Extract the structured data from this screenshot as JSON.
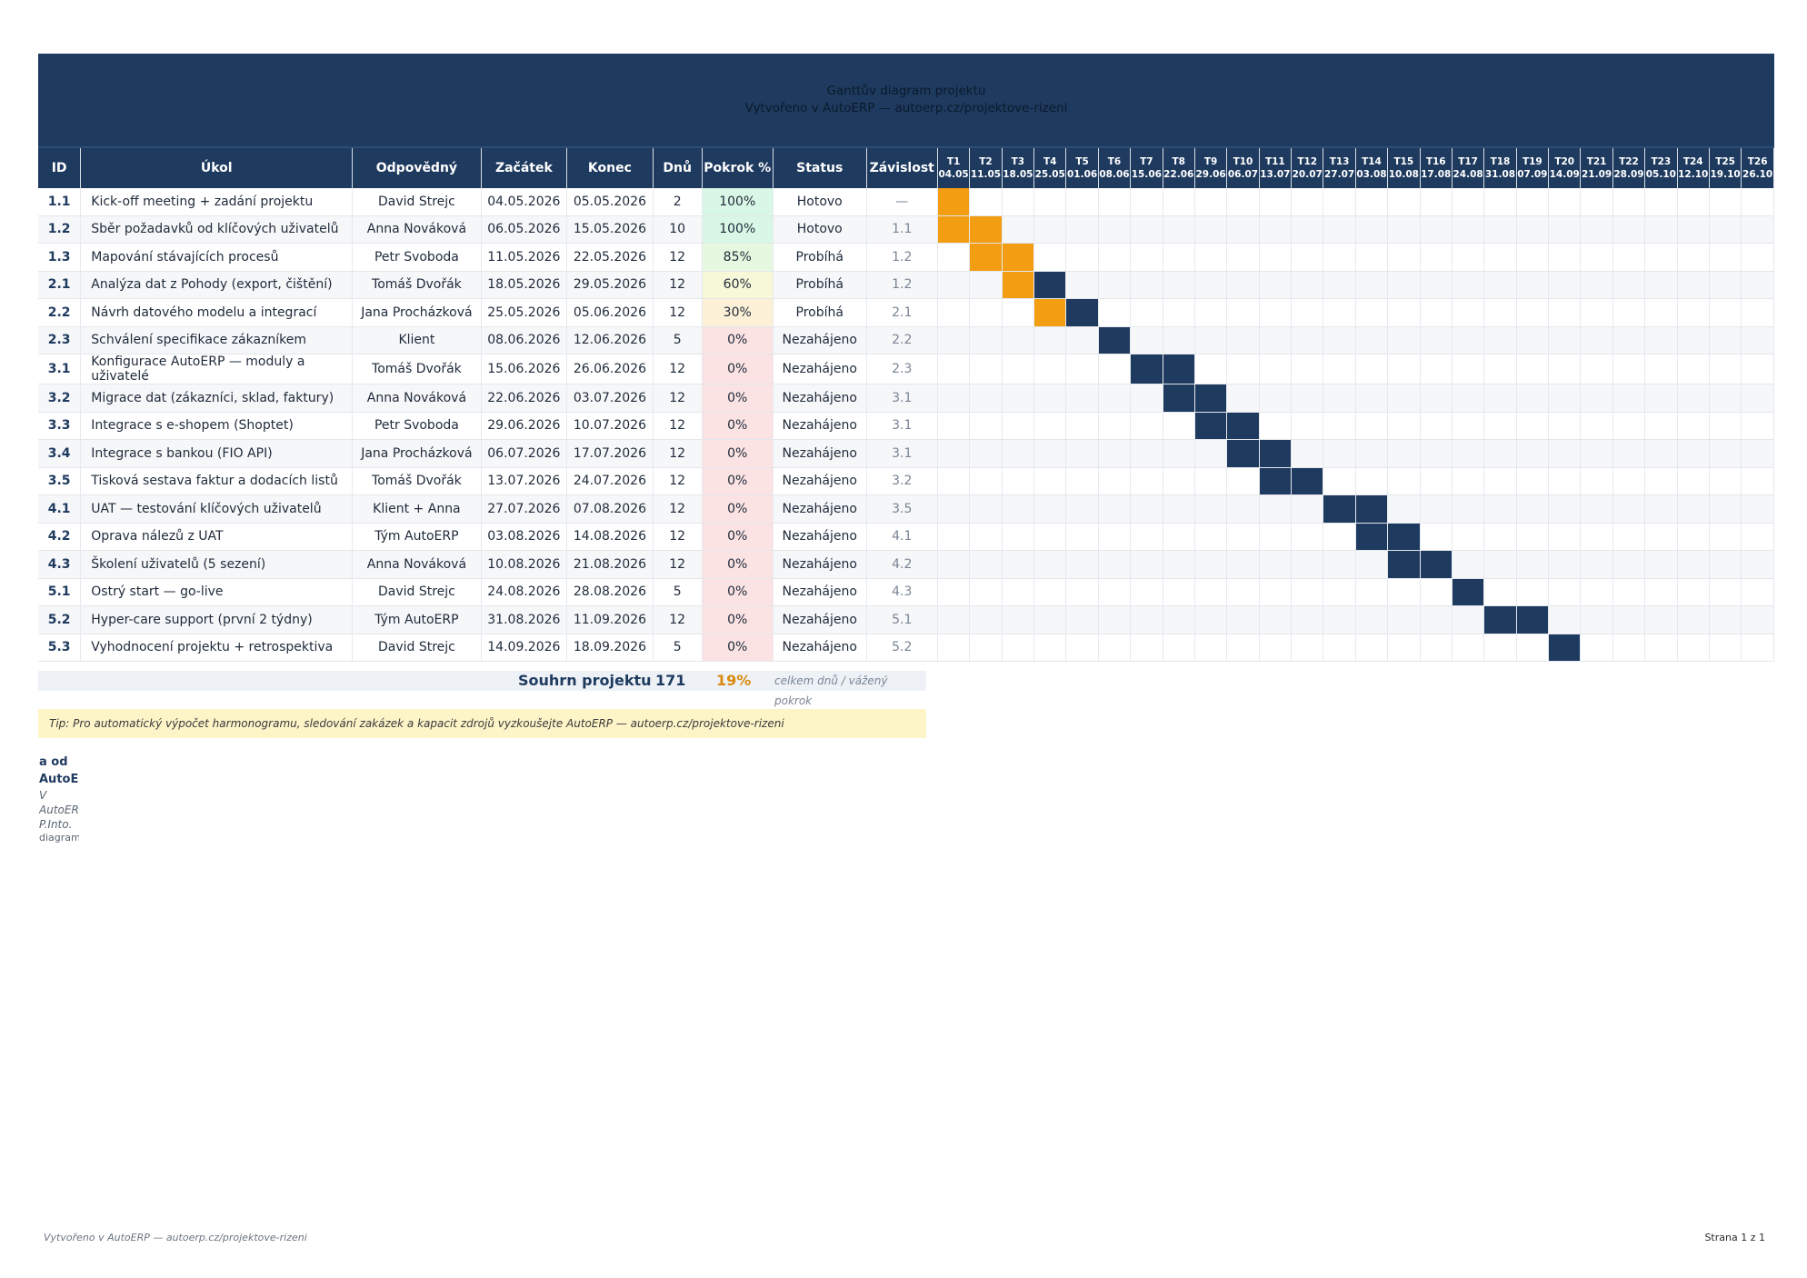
{
  "banner": {
    "title": "Ganttův diagram projektu",
    "subtitle": "Vytvořeno v AutoERP — autoerp.cz/projektove-rizeni"
  },
  "columns": {
    "id": "ID",
    "task": "Úkol",
    "owner": "Odpovědný",
    "start": "Začátek",
    "end": "Konec",
    "days": "Dnů",
    "progress": "Pokrok %",
    "status": "Status",
    "dependency": "Závislost"
  },
  "weeks": [
    {
      "label": "T1",
      "date": "04.05"
    },
    {
      "label": "T2",
      "date": "11.05"
    },
    {
      "label": "T3",
      "date": "18.05"
    },
    {
      "label": "T4",
      "date": "25.05"
    },
    {
      "label": "T5",
      "date": "01.06"
    },
    {
      "label": "T6",
      "date": "08.06"
    },
    {
      "label": "T7",
      "date": "15.06"
    },
    {
      "label": "T8",
      "date": "22.06"
    },
    {
      "label": "T9",
      "date": "29.06"
    },
    {
      "label": "T10",
      "date": "06.07"
    },
    {
      "label": "T11",
      "date": "13.07"
    },
    {
      "label": "T12",
      "date": "20.07"
    },
    {
      "label": "T13",
      "date": "27.07"
    },
    {
      "label": "T14",
      "date": "03.08"
    },
    {
      "label": "T15",
      "date": "10.08"
    },
    {
      "label": "T16",
      "date": "17.08"
    },
    {
      "label": "T17",
      "date": "24.08"
    },
    {
      "label": "T18",
      "date": "31.08"
    },
    {
      "label": "T19",
      "date": "07.09"
    },
    {
      "label": "T20",
      "date": "14.09"
    },
    {
      "label": "T21",
      "date": "21.09"
    },
    {
      "label": "T22",
      "date": "28.09"
    },
    {
      "label": "T23",
      "date": "05.10"
    },
    {
      "label": "T24",
      "date": "12.10"
    },
    {
      "label": "T25",
      "date": "19.10"
    },
    {
      "label": "T26",
      "date": "26.10"
    }
  ],
  "tasks": [
    {
      "id": "1.1",
      "task": "Kick-off meeting + zadání projektu",
      "owner": "David Strejc",
      "start": "04.05.2026",
      "end": "05.05.2026",
      "days": "2",
      "progress": "100%",
      "progress_color": "#d9f7e6",
      "status": "Hotovo",
      "dependency": "—",
      "bar_weeks": [
        1,
        1
      ],
      "bar_color": "#f29d12"
    },
    {
      "id": "1.2",
      "task": "Sběr požadavků od klíčových uživatelů",
      "owner": "Anna Nováková",
      "start": "06.05.2026",
      "end": "15.05.2026",
      "days": "10",
      "progress": "100%",
      "progress_color": "#d9f7e6",
      "status": "Hotovo",
      "dependency": "1.1",
      "bar_weeks": [
        1,
        2
      ],
      "bar_color": "#f29d12"
    },
    {
      "id": "1.3",
      "task": "Mapování stávajících procesů",
      "owner": "Petr Svoboda",
      "start": "11.05.2026",
      "end": "22.05.2026",
      "days": "12",
      "progress": "85%",
      "progress_color": "#e6f8df",
      "status": "Probíhá",
      "dependency": "1.2",
      "bar_weeks": [
        2,
        3
      ],
      "bar_color": "#f29d12"
    },
    {
      "id": "2.1",
      "task": "Analýza dat z Pohody (export, čištění)",
      "owner": "Tomáš Dvořák",
      "start": "18.05.2026",
      "end": "29.05.2026",
      "days": "12",
      "progress": "60%",
      "progress_color": "#f7f8d8",
      "status": "Probíhá",
      "dependency": "1.2",
      "bar_weeks": [
        3,
        4
      ],
      "bar_color": "split"
    },
    {
      "id": "2.2",
      "task": "Návrh datového modelu a integrací",
      "owner": "Jana Procházková",
      "start": "25.05.2026",
      "end": "05.06.2026",
      "days": "12",
      "progress": "30%",
      "progress_color": "#fcf0d6",
      "status": "Probíhá",
      "dependency": "2.1",
      "bar_weeks": [
        4,
        5
      ],
      "bar_color": "split"
    },
    {
      "id": "2.3",
      "task": "Schválení specifikace zákazníkem",
      "owner": "Klient",
      "start": "08.06.2026",
      "end": "12.06.2026",
      "days": "5",
      "progress": "0%",
      "progress_color": "#fbe3e3",
      "status": "Nezahájeno",
      "dependency": "2.2",
      "bar_weeks": [
        6,
        6
      ],
      "bar_color": "#1e3a5f"
    },
    {
      "id": "3.1",
      "task": "Konfigurace AutoERP — moduly a uživatelé",
      "owner": "Tomáš Dvořák",
      "start": "15.06.2026",
      "end": "26.06.2026",
      "days": "12",
      "progress": "0%",
      "progress_color": "#fbe3e3",
      "status": "Nezahájeno",
      "dependency": "2.3",
      "bar_weeks": [
        7,
        8
      ],
      "bar_color": "#1e3a5f"
    },
    {
      "id": "3.2",
      "task": "Migrace dat (zákazníci, sklad, faktury)",
      "owner": "Anna Nováková",
      "start": "22.06.2026",
      "end": "03.07.2026",
      "days": "12",
      "progress": "0%",
      "progress_color": "#fbe3e3",
      "status": "Nezahájeno",
      "dependency": "3.1",
      "bar_weeks": [
        8,
        9
      ],
      "bar_color": "#1e3a5f"
    },
    {
      "id": "3.3",
      "task": "Integrace s e-shopem (Shoptet)",
      "owner": "Petr Svoboda",
      "start": "29.06.2026",
      "end": "10.07.2026",
      "days": "12",
      "progress": "0%",
      "progress_color": "#fbe3e3",
      "status": "Nezahájeno",
      "dependency": "3.1",
      "bar_weeks": [
        9,
        10
      ],
      "bar_color": "#1e3a5f"
    },
    {
      "id": "3.4",
      "task": "Integrace s bankou (FIO API)",
      "owner": "Jana Procházková",
      "start": "06.07.2026",
      "end": "17.07.2026",
      "days": "12",
      "progress": "0%",
      "progress_color": "#fbe3e3",
      "status": "Nezahájeno",
      "dependency": "3.1",
      "bar_weeks": [
        10,
        11
      ],
      "bar_color": "#1e3a5f"
    },
    {
      "id": "3.5",
      "task": "Tisková sestava faktur a dodacích listů",
      "owner": "Tomáš Dvořák",
      "start": "13.07.2026",
      "end": "24.07.2026",
      "days": "12",
      "progress": "0%",
      "progress_color": "#fbe3e3",
      "status": "Nezahájeno",
      "dependency": "3.2",
      "bar_weeks": [
        11,
        12
      ],
      "bar_color": "#1e3a5f"
    },
    {
      "id": "4.1",
      "task": "UAT — testování klíčových uživatelů",
      "owner": "Klient + Anna",
      "start": "27.07.2026",
      "end": "07.08.2026",
      "days": "12",
      "progress": "0%",
      "progress_color": "#fbe3e3",
      "status": "Nezahájeno",
      "dependency": "3.5",
      "bar_weeks": [
        13,
        14
      ],
      "bar_color": "#1e3a5f"
    },
    {
      "id": "4.2",
      "task": "Oprava nálezů z UAT",
      "owner": "Tým AutoERP",
      "start": "03.08.2026",
      "end": "14.08.2026",
      "days": "12",
      "progress": "0%",
      "progress_color": "#fbe3e3",
      "status": "Nezahájeno",
      "dependency": "4.1",
      "bar_weeks": [
        14,
        15
      ],
      "bar_color": "#1e3a5f"
    },
    {
      "id": "4.3",
      "task": "Školení uživatelů (5 sezení)",
      "owner": "Anna Nováková",
      "start": "10.08.2026",
      "end": "21.08.2026",
      "days": "12",
      "progress": "0%",
      "progress_color": "#fbe3e3",
      "status": "Nezahájeno",
      "dependency": "4.2",
      "bar_weeks": [
        15,
        16
      ],
      "bar_color": "#1e3a5f"
    },
    {
      "id": "5.1",
      "task": "Ostrý start — go-live",
      "owner": "David Strejc",
      "start": "24.08.2026",
      "end": "28.08.2026",
      "days": "5",
      "progress": "0%",
      "progress_color": "#fbe3e3",
      "status": "Nezahájeno",
      "dependency": "4.3",
      "bar_weeks": [
        17,
        17
      ],
      "bar_color": "#1e3a5f"
    },
    {
      "id": "5.2",
      "task": "Hyper-care support (první 2 týdny)",
      "owner": "Tým AutoERP",
      "start": "31.08.2026",
      "end": "11.09.2026",
      "days": "12",
      "progress": "0%",
      "progress_color": "#fbe3e3",
      "status": "Nezahájeno",
      "dependency": "5.1",
      "bar_weeks": [
        18,
        19
      ],
      "bar_color": "#1e3a5f"
    },
    {
      "id": "5.3",
      "task": "Vyhodnocení projektu + retrospektiva",
      "owner": "David Strejc",
      "start": "14.09.2026",
      "end": "18.09.2026",
      "days": "5",
      "progress": "0%",
      "progress_color": "#fbe3e3",
      "status": "Nezahájeno",
      "dependency": "5.2",
      "bar_weeks": [
        20,
        20
      ],
      "bar_color": "#1e3a5f"
    }
  ],
  "summary": {
    "label": "Souhrn projektu",
    "total_days": "171",
    "weighted_progress": "19%",
    "note": "celkem dnů / vážený pokrok"
  },
  "tip": "Tip: Pro automatický výpočet harmonogramu, sledování zakázek a kapacit zdrojů vyzkoušejte AutoERP — autoerp.cz/projektove-rizeni",
  "side_fragment": {
    "line1": "a od",
    "line2": "AutoE",
    "line3": "V",
    "line4": "AutoER",
    "line5": "P.Into.",
    "line6": "diagram"
  },
  "footer": {
    "left": "Vytvořeno v AutoERP — autoerp.cz/projektove-rizeni",
    "right": "Strana 1 z 1"
  },
  "colors": {
    "navy": "#1e3a5f",
    "orange": "#f29d12",
    "summary_orange": "#d98a0e"
  }
}
